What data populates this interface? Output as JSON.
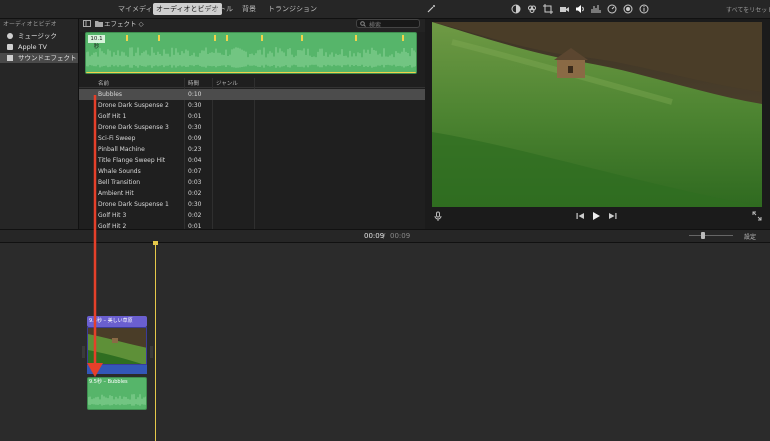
{
  "tabs": {
    "my_media": "マイメディア",
    "audio_video": "オーディオとビデオ",
    "titles": "タイトル",
    "backgrounds": "背景",
    "transitions": "トランジション"
  },
  "toolbar": {
    "reset_all": "すべてをリセット"
  },
  "sidebar": {
    "section": "オーディオとビデオ",
    "items": [
      {
        "label": "ミュージック",
        "icon": "music-icon"
      },
      {
        "label": "Apple TV",
        "icon": "tv-icon"
      },
      {
        "label": "サウンドエフェクト",
        "icon": "speaker-icon"
      }
    ]
  },
  "browser": {
    "folder": "エフェクト ◇",
    "search_placeholder": "検索",
    "waveform_time": "10.1秒",
    "columns": {
      "name": "名前",
      "duration": "時間",
      "genre": "ジャンル"
    },
    "rows": [
      {
        "name": "Bubbles",
        "duration": "0:10"
      },
      {
        "name": "Drone Dark Suspense 2",
        "duration": "0:30"
      },
      {
        "name": "Golf Hit 1",
        "duration": "0:01"
      },
      {
        "name": "Drone Dark Suspense 3",
        "duration": "0:30"
      },
      {
        "name": "Sci-Fi Sweep",
        "duration": "0:09"
      },
      {
        "name": "Pinball Machine",
        "duration": "0:23"
      },
      {
        "name": "Title Flange Sweep Hit",
        "duration": "0:04"
      },
      {
        "name": "Whale Sounds",
        "duration": "0:07"
      },
      {
        "name": "Bell Transition",
        "duration": "0:03"
      },
      {
        "name": "Ambient Hit",
        "duration": "0:02"
      },
      {
        "name": "Drone Dark Suspense 1",
        "duration": "0:30"
      },
      {
        "name": "Golf Hit 3",
        "duration": "0:02"
      },
      {
        "name": "Golf Hit 2",
        "duration": "0:01"
      }
    ]
  },
  "timeline": {
    "current": "00:09",
    "separator": "/",
    "total": "00:09",
    "settings": "設定",
    "title_clip": "9.5秒 – 美しい草原",
    "audio_clip": "9.5秒 – Bubbles"
  },
  "colors": {
    "accent_arrow": "#e5402a",
    "audio_green": "#56b56a",
    "title_purple": "#6a5fd0",
    "playhead": "#e5c84a"
  }
}
